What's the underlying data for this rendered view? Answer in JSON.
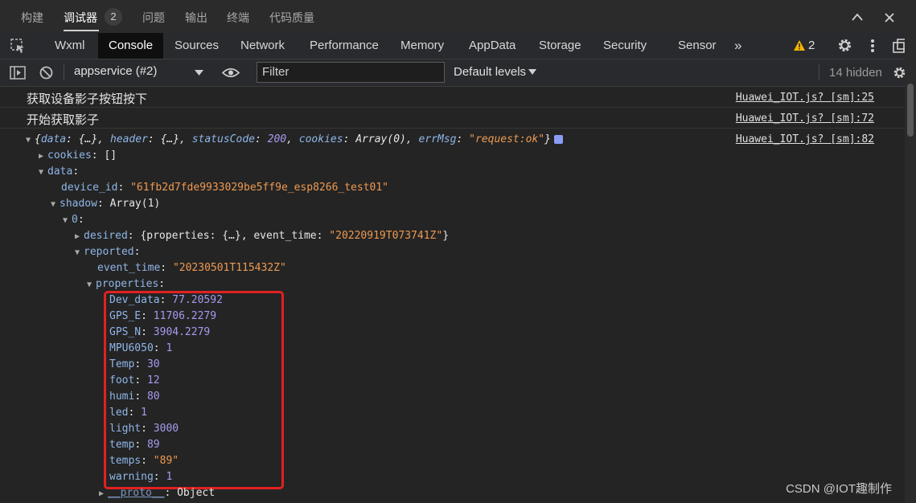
{
  "top_tabs": [
    "构建",
    "调试器",
    "问题",
    "输出",
    "终端",
    "代码质量"
  ],
  "top_active": "调试器",
  "debugger_badge": "2",
  "devtools_tabs": [
    "Wxml",
    "Console",
    "Sources",
    "Network",
    "Performance",
    "Memory",
    "AppData",
    "Storage",
    "Security",
    "Sensor"
  ],
  "devtools_active": "Console",
  "more_tabs_label": "»",
  "warnings_count": "2",
  "toolbar": {
    "context": "appservice (#2)",
    "filter_placeholder": "Filter",
    "levels": "Default levels",
    "hidden": "14 hidden"
  },
  "messages": [
    {
      "text": "获取设备影子按钮按下",
      "source": "Huawei_IOT.js? [sm]:25"
    },
    {
      "text": "开始获取影子",
      "source": "Huawei_IOT.js? [sm]:72"
    }
  ],
  "object_source": "Huawei_IOT.js? [sm]:82",
  "summary": {
    "open": "{",
    "data_key": "data",
    "data_val": "{…}",
    "header_key": "header",
    "header_val": "{…}",
    "status_key": "statusCode",
    "status_val": "200",
    "cookies_key": "cookies",
    "cookies_val": "Array(0)",
    "err_key": "errMsg",
    "err_val": "\"request:ok\"",
    "close": "}"
  },
  "tree": {
    "cookies": {
      "key": "cookies",
      "val": "[]"
    },
    "data_key": "data",
    "device_id": {
      "key": "device_id",
      "val": "\"61fb2d7fde9933029be5ff9e_esp8266_test01\""
    },
    "shadow": {
      "key": "shadow",
      "val": "Array(1)"
    },
    "idx": "0",
    "desired": {
      "key": "desired",
      "pre": "{",
      "k1": "properties",
      "v1": "{…}",
      "k2": "event_time",
      "v2": "\"20220919T073741Z\"",
      "post": "}"
    },
    "reported_key": "reported",
    "event_time": {
      "key": "event_time",
      "val": "\"20230501T115432Z\""
    },
    "properties_key": "properties",
    "properties": [
      {
        "key": "Dev_data",
        "val": "77.20592",
        "type": "n"
      },
      {
        "key": "GPS_E",
        "val": "11706.2279",
        "type": "n"
      },
      {
        "key": "GPS_N",
        "val": "3904.2279",
        "type": "n"
      },
      {
        "key": "MPU6050",
        "val": "1",
        "type": "n"
      },
      {
        "key": "Temp",
        "val": "30",
        "type": "n"
      },
      {
        "key": "foot",
        "val": "12",
        "type": "n"
      },
      {
        "key": "humi",
        "val": "80",
        "type": "n"
      },
      {
        "key": "led",
        "val": "1",
        "type": "n"
      },
      {
        "key": "light",
        "val": "3000",
        "type": "n"
      },
      {
        "key": "temp",
        "val": "89",
        "type": "n"
      },
      {
        "key": "temps",
        "val": "\"89\"",
        "type": "s"
      },
      {
        "key": "warning",
        "val": "1",
        "type": "n"
      }
    ],
    "proto": {
      "key": "__proto__",
      "val": "Object"
    }
  },
  "watermark": "CSDN @IOT趣制作",
  "colors": {
    "key": "#8fb6e8",
    "string": "#ee9a52",
    "number": "#a59bf0",
    "highlight": "#e12121",
    "warning": "#f5b400"
  }
}
